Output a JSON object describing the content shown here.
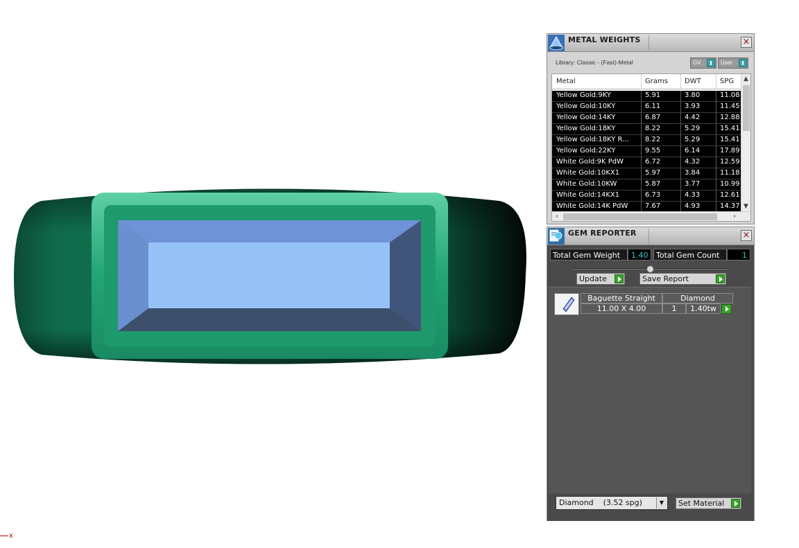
{
  "axis_label": "x",
  "metal_weights": {
    "title": "METAL WEIGHTS",
    "library": "Library: Classic - (Fast)-Metal",
    "toggle_gv": "GV",
    "toggle_user": "User",
    "columns": [
      "Metal",
      "Grams",
      "DWT",
      "SPG"
    ],
    "rows": [
      [
        "Yellow Gold:9KY",
        "5.91",
        "3.80",
        "11.08"
      ],
      [
        "Yellow Gold:10KY",
        "6.11",
        "3.93",
        "11.45"
      ],
      [
        "Yellow Gold:14KY",
        "6.87",
        "4.42",
        "12.88"
      ],
      [
        "Yellow Gold:18KY",
        "8.22",
        "5.29",
        "15.41"
      ],
      [
        "Yellow Gold:18KY R...",
        "8.22",
        "5.29",
        "15.41"
      ],
      [
        "Yellow Gold:22KY",
        "9.55",
        "6.14",
        "17.89"
      ],
      [
        "White Gold:9K PdW",
        "6.72",
        "4.32",
        "12.59"
      ],
      [
        "White Gold:10KX1",
        "5.97",
        "3.84",
        "11.18"
      ],
      [
        "White Gold:10KW",
        "5.87",
        "3.77",
        "10.99"
      ],
      [
        "White Gold:14KX1",
        "6.73",
        "4.33",
        "12.61"
      ],
      [
        "White Gold:14K PdW",
        "7.67",
        "4.93",
        "14.37"
      ]
    ]
  },
  "gem_reporter": {
    "title": "GEM REPORTER",
    "total_weight_label": "Total Gem Weight",
    "total_weight_value": "1.40",
    "total_count_label": "Total Gem Count",
    "total_count_value": "1",
    "update_label": "Update",
    "save_label": "Save Report",
    "gem": {
      "shape": "Baguette Straight",
      "material": "Diamond",
      "size": "11.00 X 4.00",
      "qty": "1",
      "carat": "1.40tw"
    },
    "material_select": "Diamond    (3.52 spg)",
    "set_material_label": "Set Material"
  }
}
